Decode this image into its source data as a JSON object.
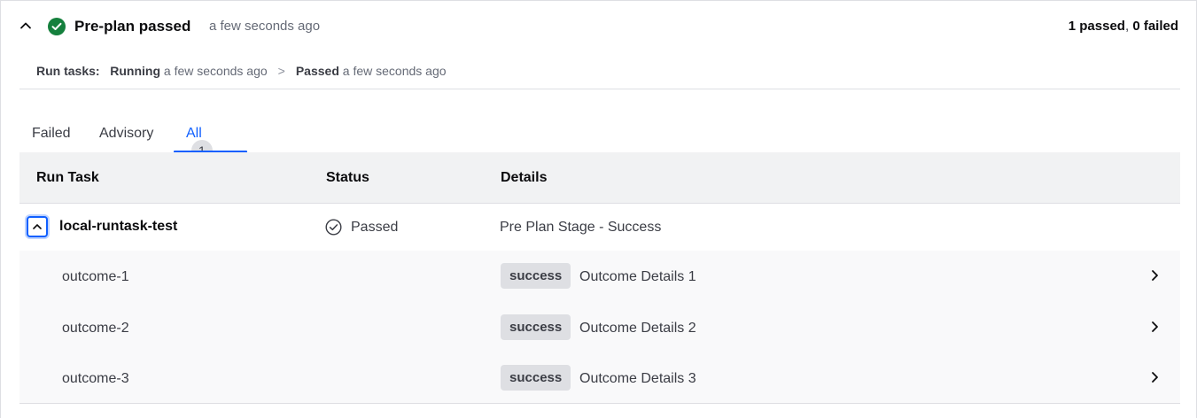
{
  "header": {
    "title": "Pre-plan passed",
    "time": "a few seconds ago",
    "summary_passed": "1 passed",
    "summary_sep": ", ",
    "summary_failed": "0 failed"
  },
  "run_tasks": {
    "label": "Run tasks:",
    "step1_status": "Running",
    "step1_time": "a few seconds ago",
    "separator": ">",
    "step2_status": "Passed",
    "step2_time": "a few seconds ago"
  },
  "tabs": [
    {
      "label": "Failed"
    },
    {
      "label": "Advisory"
    },
    {
      "label": "All",
      "count": "1"
    }
  ],
  "table": {
    "columns": [
      "Run Task",
      "Status",
      "Details"
    ],
    "task": {
      "name": "local-runtask-test",
      "status": "Passed",
      "details": "Pre Plan Stage - Success"
    },
    "outcomes": [
      {
        "name": "outcome-1",
        "badge": "success",
        "details": "Outcome Details 1"
      },
      {
        "name": "outcome-2",
        "badge": "success",
        "details": "Outcome Details 2"
      },
      {
        "name": "outcome-3",
        "badge": "success",
        "details": "Outcome Details 3"
      }
    ]
  },
  "colors": {
    "success": "#15803d",
    "accent": "#1060ff",
    "header_bg": "#f1f2f3",
    "badge_bg": "#dedfe3"
  },
  "icons": {
    "collapse": "chevron-up-icon",
    "status": "check-circle-icon",
    "passed": "check-circle-outline-icon",
    "row_expand": "chevron-right-icon"
  }
}
